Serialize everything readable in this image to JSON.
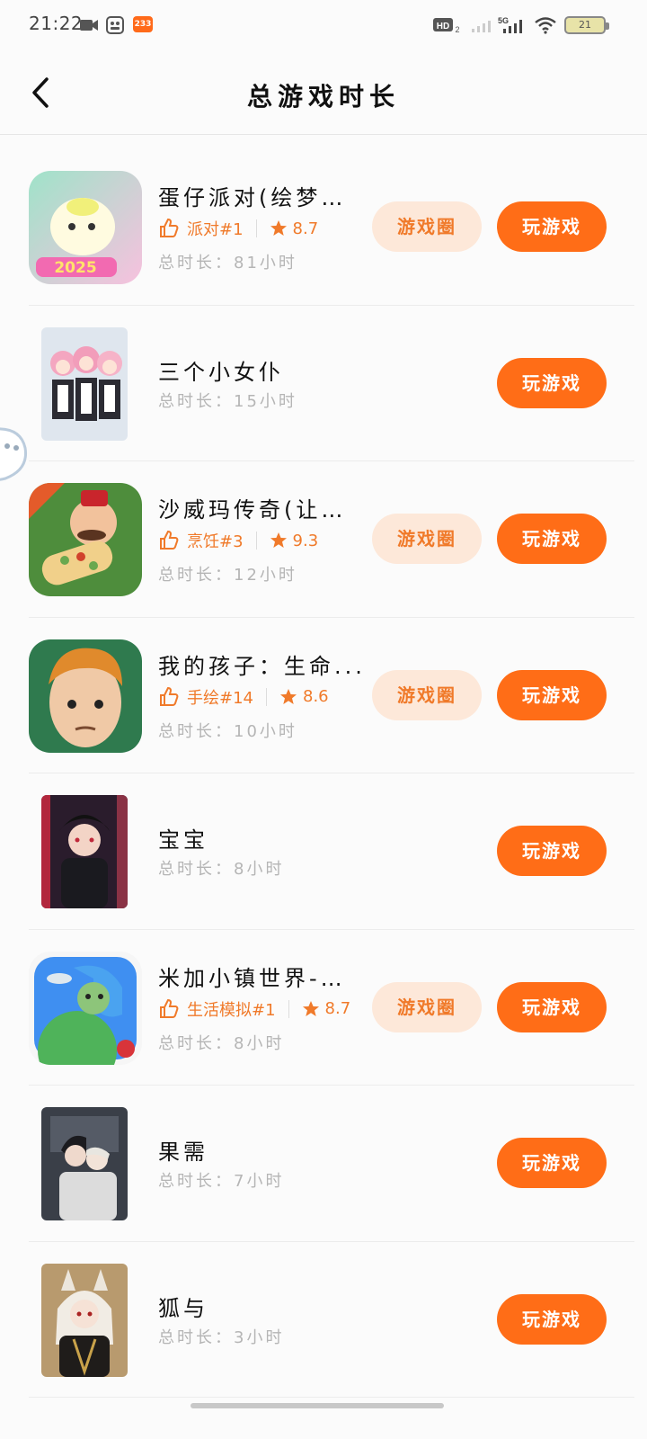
{
  "status_bar": {
    "time": "21:22",
    "badge_233": "233",
    "battery": "21"
  },
  "header": {
    "title": "总游戏时长"
  },
  "games": [
    {
      "name": "蛋仔派对(绘梦校...",
      "rank": "派对#1",
      "rating": "8.7",
      "duration": "总时长：81小时",
      "circle_label": "游戏圈",
      "play_label": "玩游戏"
    },
    {
      "name": "三个小女仆",
      "duration": "总时长：15小时",
      "play_label": "玩游戏"
    },
    {
      "name": "沙威玛传奇(让我...",
      "rank": "烹饪#3",
      "rating": "9.3",
      "duration": "总时长：12小时",
      "circle_label": "游戏圈",
      "play_label": "玩游戏"
    },
    {
      "name": "我的孩子：生命...",
      "rank": "手绘#14",
      "rating": "8.6",
      "duration": "总时长：10小时",
      "circle_label": "游戏圈",
      "play_label": "玩游戏"
    },
    {
      "name": "宝宝",
      "duration": "总时长：8小时",
      "play_label": "玩游戏"
    },
    {
      "name": "米加小镇世界-黄...",
      "rank": "生活模拟#1",
      "rating": "8.7",
      "duration": "总时长：8小时",
      "circle_label": "游戏圈",
      "play_label": "玩游戏"
    },
    {
      "name": "果需",
      "duration": "总时长：7小时",
      "play_label": "玩游戏"
    },
    {
      "name": "狐与",
      "duration": "总时长：3小时",
      "play_label": "玩游戏"
    }
  ],
  "colors": {
    "accent": "#ff6d17",
    "accent_light": "#fde8d9",
    "rank_text": "#f07a2a"
  }
}
